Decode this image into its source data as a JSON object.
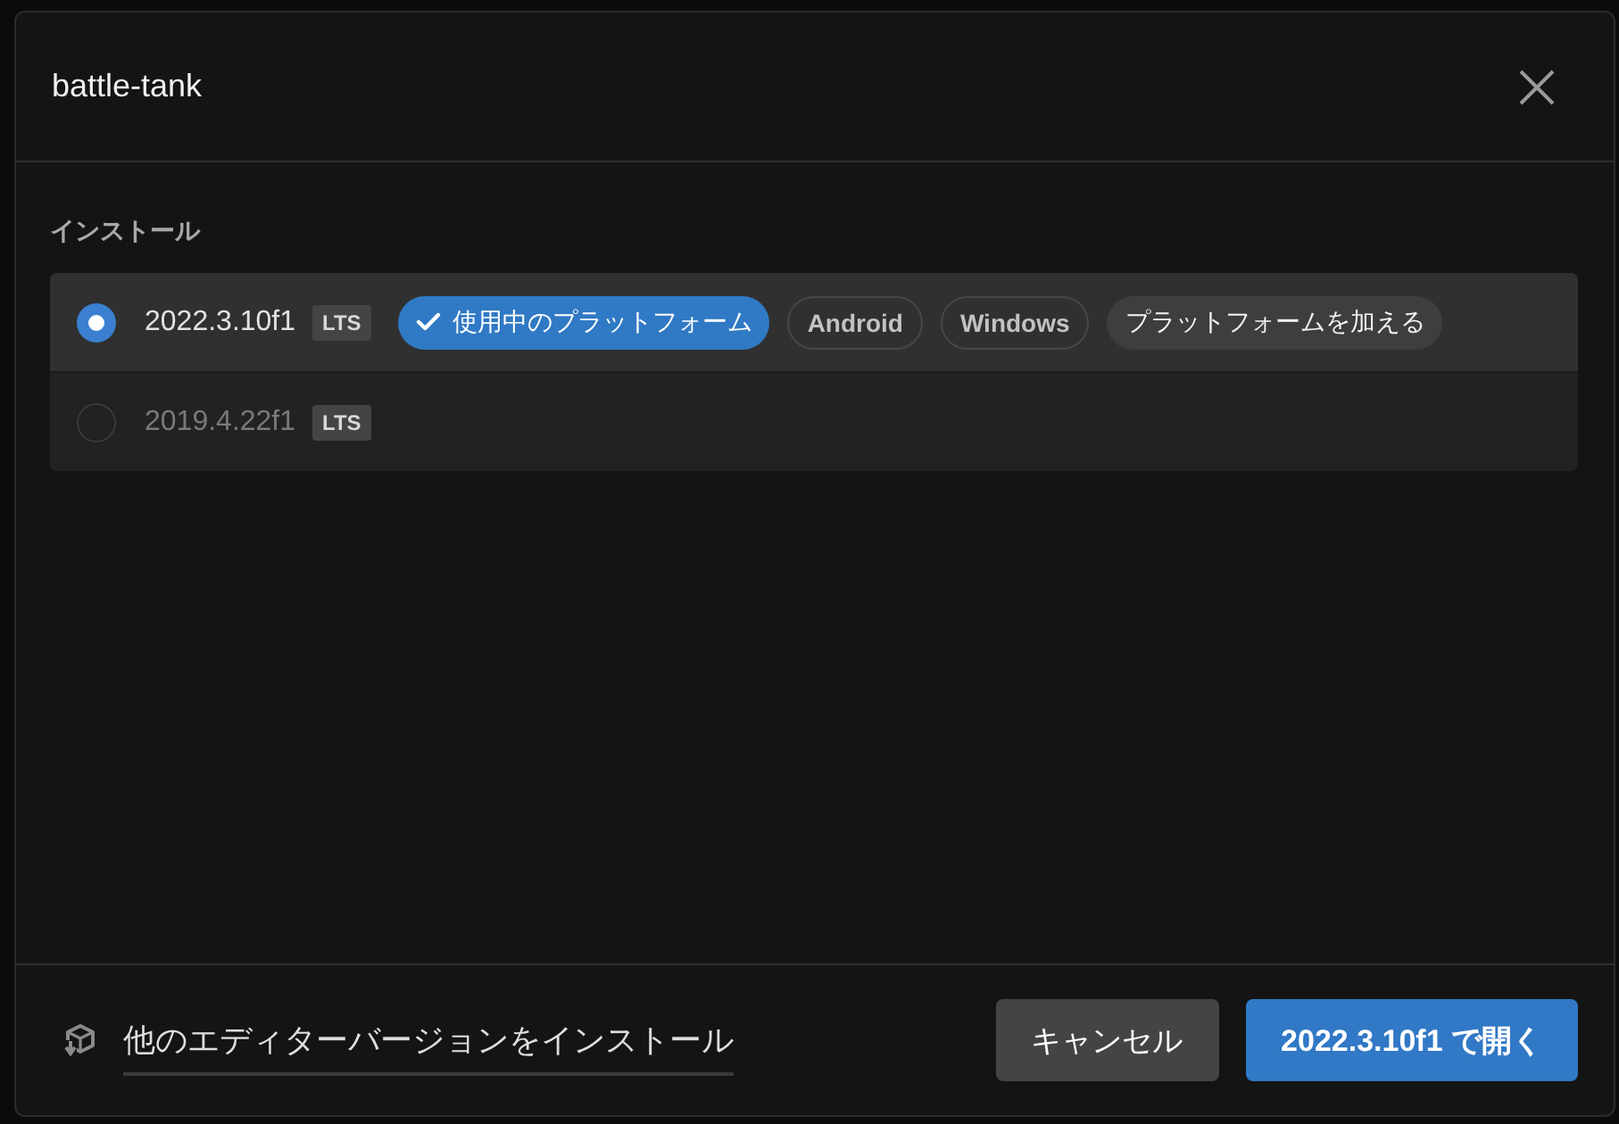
{
  "dialog": {
    "title": "battle-tank"
  },
  "section": {
    "label": "インストール"
  },
  "installs": [
    {
      "version": "2022.3.10f1",
      "badge": "LTS",
      "selected": true,
      "chips": [
        {
          "kind": "active",
          "label": "使用中のプラットフォーム"
        },
        {
          "kind": "platform",
          "label": "Android"
        },
        {
          "kind": "platform",
          "label": "Windows"
        },
        {
          "kind": "add",
          "label": "プラットフォームを加える"
        }
      ]
    },
    {
      "version": "2019.4.22f1",
      "badge": "LTS",
      "selected": false
    }
  ],
  "footer": {
    "link": "他のエディターバージョンをインストール",
    "buttons": [
      {
        "kind": "secondary",
        "label": "キャンセル"
      },
      {
        "kind": "primary",
        "label": "2022.3.10f1 で開く"
      }
    ]
  }
}
